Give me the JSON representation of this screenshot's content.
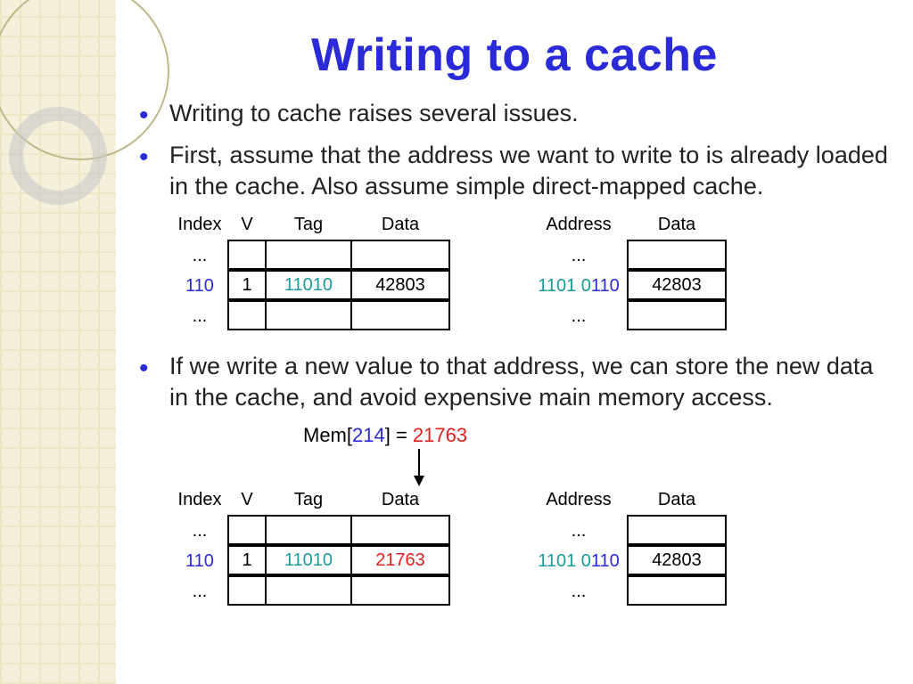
{
  "title": "Writing to a cache",
  "bullets": {
    "b1": "Writing to cache raises several issues.",
    "b2": "First, assume that the address we want to write to is already loaded in the cache. Also assume simple direct-mapped cache.",
    "b3": "If we write a new value to that address, we can store the new data in the cache, and avoid expensive main memory access."
  },
  "headers": {
    "index": "Index",
    "v": "V",
    "tag": "Tag",
    "data": "Data",
    "address": "Address"
  },
  "ellipsis": "...",
  "cache1": {
    "index": "110",
    "v": "1",
    "tag": "11010",
    "data": "42803"
  },
  "mem1": {
    "addr_a": "1101 0",
    "addr_b": "110",
    "data": "42803"
  },
  "mem_expr": {
    "pre": "Mem[",
    "addr": "214",
    "mid": "] = ",
    "val": "21763"
  },
  "cache2": {
    "index": "110",
    "v": "1",
    "tag": "11010",
    "data": "21763"
  },
  "mem2": {
    "addr_a": "1101 0",
    "addr_b": "110",
    "data": "42803"
  }
}
